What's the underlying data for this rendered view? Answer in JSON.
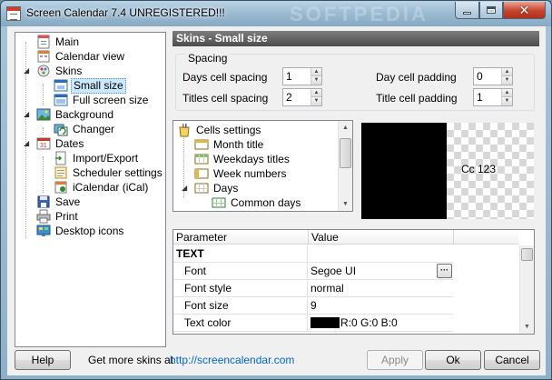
{
  "window": {
    "title": "Screen Calendar 7.4 UNREGISTERED!!!",
    "watermark": "SOFTPEDIA"
  },
  "nav_tree": {
    "items": [
      {
        "label": "Main",
        "icon": "main-icon"
      },
      {
        "label": "Calendar view",
        "icon": "calendar-view-icon"
      },
      {
        "label": "Skins",
        "icon": "skins-icon"
      },
      {
        "label": "Small size",
        "icon": "small-size-icon",
        "selected": true
      },
      {
        "label": "Full screen size",
        "icon": "full-screen-icon"
      },
      {
        "label": "Background",
        "icon": "background-icon"
      },
      {
        "label": "Changer",
        "icon": "changer-icon"
      },
      {
        "label": "Dates",
        "icon": "dates-icon"
      },
      {
        "label": "Import/Export",
        "icon": "import-export-icon"
      },
      {
        "label": "Scheduler settings",
        "icon": "scheduler-icon"
      },
      {
        "label": "iCalendar (iCal)",
        "icon": "icalendar-icon"
      },
      {
        "label": "Save",
        "icon": "save-icon"
      },
      {
        "label": "Print",
        "icon": "print-icon"
      },
      {
        "label": "Desktop icons",
        "icon": "desktop-icons-icon"
      }
    ]
  },
  "panel": {
    "header": "Skins - Small size",
    "spacing_group": "Spacing",
    "days_cell_spacing_label": "Days cell spacing",
    "days_cell_spacing_value": "1",
    "titles_cell_spacing_label": "Titles cell spacing",
    "titles_cell_spacing_value": "2",
    "day_cell_padding_label": "Day cell padding",
    "day_cell_padding_value": "0",
    "title_cell_padding_label": "Title cell padding",
    "title_cell_padding_value": "1"
  },
  "cells_tree": {
    "items": [
      {
        "label": "Cells settings"
      },
      {
        "label": "Month title"
      },
      {
        "label": "Weekdays titles"
      },
      {
        "label": "Week numbers"
      },
      {
        "label": "Days"
      },
      {
        "label": "Common days"
      }
    ]
  },
  "preview": {
    "sample_text": "Cc 123"
  },
  "property_grid": {
    "col_parameter": "Parameter",
    "col_value": "Value",
    "rows": [
      {
        "parameter": "TEXT",
        "value": ""
      },
      {
        "parameter": "Font",
        "value": "Segoe UI"
      },
      {
        "parameter": "Font style",
        "value": "normal"
      },
      {
        "parameter": "Font size",
        "value": "9"
      },
      {
        "parameter": "Text color",
        "value": "R:0 G:0 B:0"
      }
    ],
    "ellipsis": "···"
  },
  "footer": {
    "help_label": "Help",
    "more_skins_text": "Get more skins at",
    "link_text": "http://screencalendar.com",
    "apply_label": "Apply",
    "ok_label": "Ok",
    "cancel_label": "Cancel"
  },
  "colors": {
    "header_bg": "#5a5a5a",
    "selection": "#cce8ff",
    "link": "#0066cc",
    "text_color_swatch": "#000000"
  }
}
